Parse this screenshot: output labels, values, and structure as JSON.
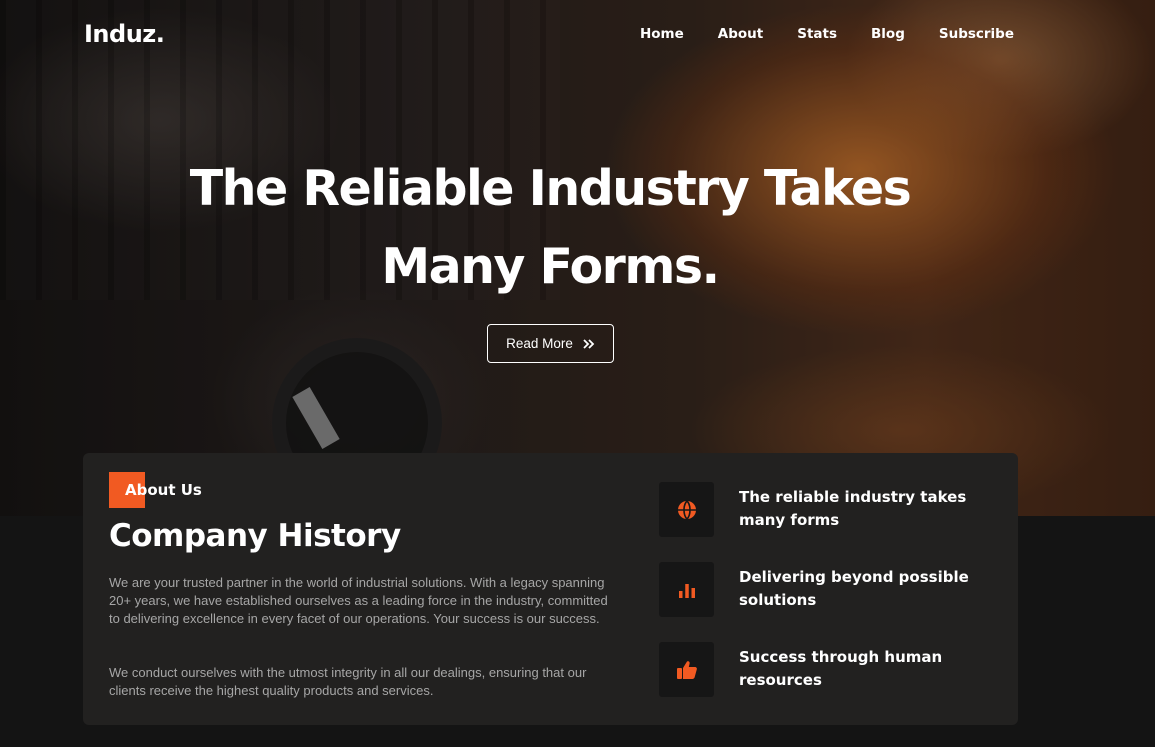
{
  "brand": {
    "logo": "Induz."
  },
  "nav": {
    "items": [
      {
        "label": "Home"
      },
      {
        "label": "About"
      },
      {
        "label": "Stats"
      },
      {
        "label": "Blog"
      },
      {
        "label": "Subscribe"
      }
    ]
  },
  "hero": {
    "title_line1": "The Reliable Industry Takes",
    "title_line2": "Many Forms.",
    "button_label": "Read More",
    "button_icon": "double-chevron-right-icon"
  },
  "about": {
    "tag": "About Us",
    "title": "Company History",
    "paragraph1": "We are your trusted partner in the world of industrial solutions. With a legacy spanning 20+ years, we have established ourselves as a leading force in the industry, committed to delivering excellence in every facet of our operations. Your success is our success.",
    "paragraph2": "We conduct ourselves with the utmost integrity in all our dealings, ensuring that our clients receive the highest quality products and services.",
    "features": [
      {
        "icon": "globe-icon",
        "text": "The reliable industry takes many forms"
      },
      {
        "icon": "bar-chart-icon",
        "text": "Delivering beyond possible solutions"
      },
      {
        "icon": "thumbs-up-icon",
        "text": "Success through human resources"
      }
    ]
  },
  "colors": {
    "accent": "#f15a22",
    "background": "#141414",
    "card": "#222120",
    "icon_box": "#161616",
    "muted_text": "#a6a6a6"
  }
}
